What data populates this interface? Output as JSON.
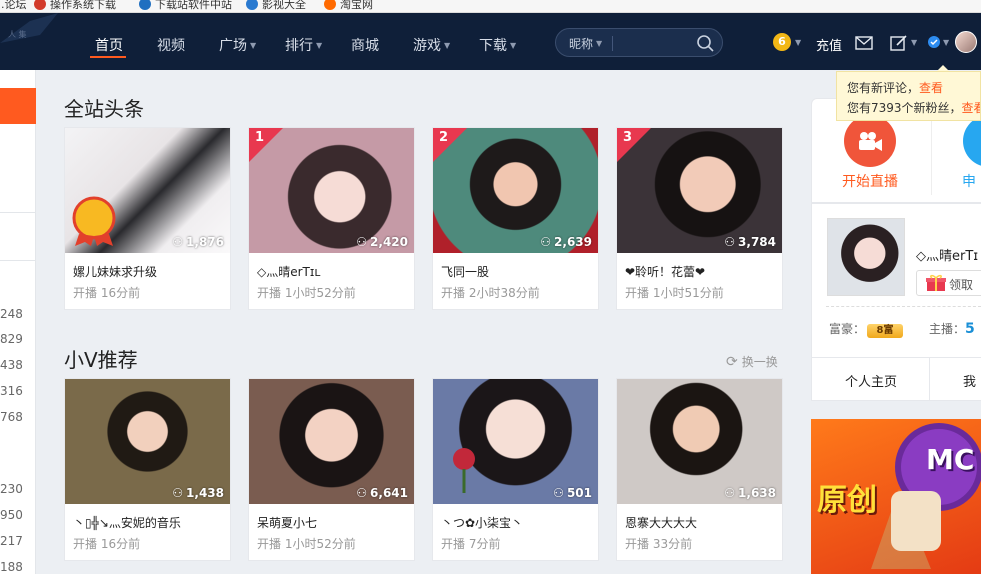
{
  "bookmarks": [
    {
      "label": "...论坛",
      "color": "#cc2222"
    },
    {
      "label": "操作系统下载",
      "color": "#d23a2a"
    },
    {
      "label": "下载站软件中站",
      "color": "#1f6fc0"
    },
    {
      "label": "影视大全",
      "color": "#2a7ad0"
    },
    {
      "label": "淘宝网",
      "color": "#ff6a00"
    }
  ],
  "nav": {
    "items": [
      {
        "label": "首页",
        "active": true
      },
      {
        "label": "视频"
      },
      {
        "label": "广场",
        "dropdown": true
      },
      {
        "label": "排行",
        "dropdown": true
      },
      {
        "label": "商城"
      },
      {
        "label": "游戏",
        "dropdown": true
      },
      {
        "label": "下载",
        "dropdown": true
      }
    ],
    "search_label": "昵称",
    "coin_level": "6",
    "recharge": "充值"
  },
  "notify": {
    "line1": "您有新评论，",
    "line1_link": "查看",
    "line2": "您有7393个新粉丝，",
    "line2_link": "查看"
  },
  "left": {
    "numbers": [
      "248",
      "829",
      "438",
      "316",
      "768",
      "230",
      "950",
      "217",
      "188"
    ]
  },
  "sections": {
    "headline_title": "全站头条",
    "recommend_title": "小V推荐",
    "refresh_label": "换一换"
  },
  "headline_cards": [
    {
      "title": "嫘儿妹妹求升级",
      "sub": "开播 16分前",
      "viewers": "1,876",
      "rank": "",
      "badge": "头条达人"
    },
    {
      "title": "◇灬晴erTɪʟ",
      "sub": "开播 1小时52分前",
      "viewers": "2,420",
      "rank": "1"
    },
    {
      "title": "飞同一股",
      "sub": "开播 2小时38分前",
      "viewers": "2,639",
      "rank": "2"
    },
    {
      "title": "❤聆听！花蕾❤",
      "sub": "开播 1小时51分前",
      "viewers": "3,784",
      "rank": "3"
    }
  ],
  "recommend_cards": [
    {
      "title": "丶▯╬↘灬安妮的音乐",
      "sub": "开播 16分前",
      "viewers": "1,438"
    },
    {
      "title": "呆萌夏小七",
      "sub": "开播 1小时52分前",
      "viewers": "6,641"
    },
    {
      "title": "丶つ✿小柒宝丶",
      "sub": "开播 7分前",
      "viewers": "501"
    },
    {
      "title": "恩寨大大大大",
      "sub": "开播 33分前",
      "viewers": "1,638"
    }
  ],
  "right": {
    "live_label": "开始直播",
    "blue_label": "申",
    "profile_name": "◇灬晴erTɪ",
    "claim_label": "领取",
    "rich_label": "富豪：",
    "rich_badge": "8富",
    "host_label": "主播：",
    "host_value": "5",
    "tab_home": "个人主页",
    "tab_mine": "我",
    "banner_text": "原创",
    "banner_logo": "MC"
  },
  "colors": {
    "nav_bg": "#0f1f39",
    "accent": "#ff5a1f",
    "rank_red": "#e8384f"
  }
}
